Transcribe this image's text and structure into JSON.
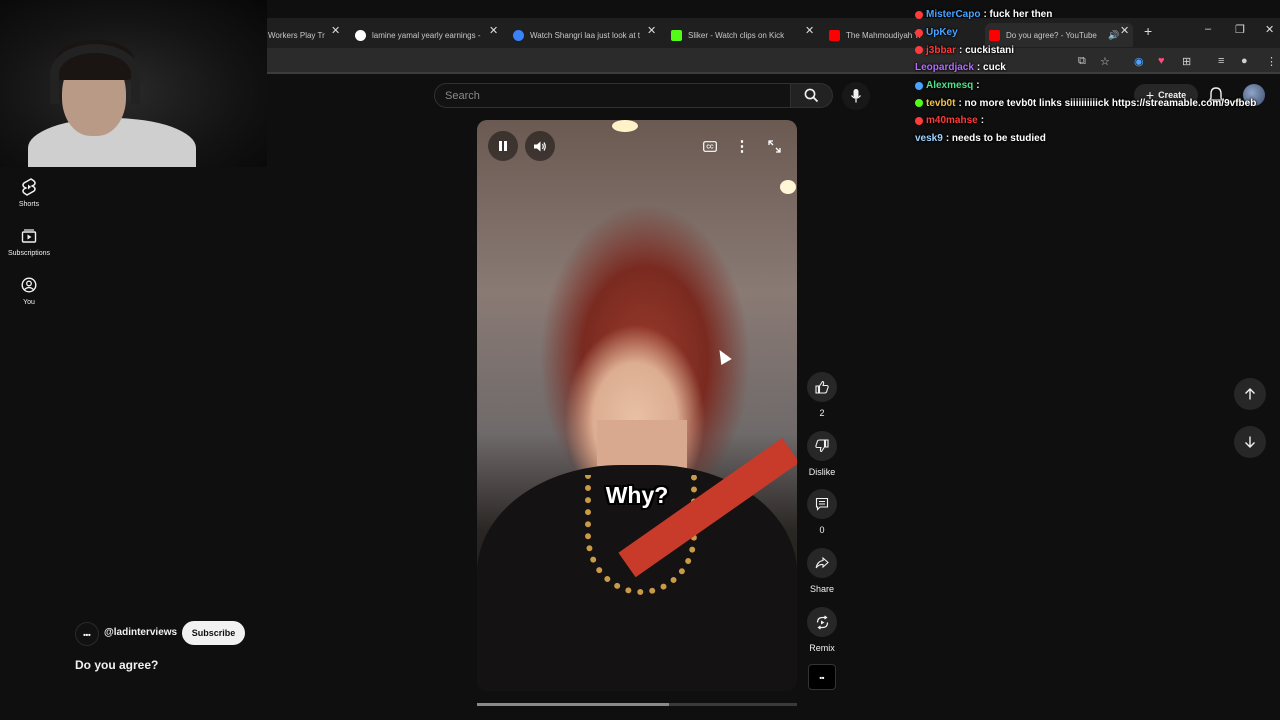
{
  "browser": {
    "tabs": [
      {
        "title": "Workers Play Tr",
        "color": "#7a7a7a"
      },
      {
        "title": "lamine yamal yearly earnings -",
        "color": "#4285f4"
      },
      {
        "title": "Watch Shangri laa just look at t",
        "color": "#3b82f6"
      },
      {
        "title": "Sliker - Watch clips on Kick",
        "color": "#53fc18"
      },
      {
        "title": "The Mahmoudiyah Tr",
        "color": "#ff0000"
      },
      {
        "title": "Do you agree? - YouTube",
        "color": "#ff0000"
      }
    ],
    "new_tab_glyph": "+",
    "close_glyph": "✕",
    "win_min": "–",
    "win_max": "❐",
    "win_close": "✕"
  },
  "sidebar": {
    "items": [
      {
        "label": "Shorts",
        "icon": "shorts-icon"
      },
      {
        "label": "Subscriptions",
        "icon": "subscriptions-icon"
      },
      {
        "label": "You",
        "icon": "you-icon"
      }
    ]
  },
  "search": {
    "placeholder": "Search"
  },
  "header": {
    "create_label": "Create"
  },
  "video": {
    "caption": "Why?",
    "title": "Do you agree?",
    "channel_handle": "@ladinterviews",
    "subscribe_label": "Subscribe",
    "progress_fraction": 0.6
  },
  "actions": {
    "like_count": "2",
    "dislike_label": "Dislike",
    "comment_count": "0",
    "share_label": "Share",
    "remix_label": "Remix"
  },
  "chat": [
    {
      "user": "MisterCapo",
      "user_color": "#4aa3ff",
      "badge": "#ff3b3b",
      "msg": ": fuck her then"
    },
    {
      "user": "UpKey",
      "user_color": "#4aa3ff",
      "badge": "#ff3b3b",
      "msg": ""
    },
    {
      "user": "j3bbar",
      "user_color": "#ff3b3b",
      "badge": "#ff3b3b",
      "msg": ": cuckistani"
    },
    {
      "user": "Leopardjack",
      "user_color": "#b46bff",
      "badge": "",
      "msg": ": cuck"
    },
    {
      "user": "Alexmesq",
      "user_color": "#4fe08a",
      "badge": "#4aa3ff",
      "msg": ":"
    },
    {
      "user": "tevb0t",
      "user_color": "#f0c24a",
      "badge": "#53fc18",
      "msg": ": no more tevb0t links siiiiiiiiiick https://streamable.com/9vfbeb"
    },
    {
      "user": "m40mahse",
      "user_color": "#ff3b3b",
      "badge": "#ff3b3b",
      "msg": ":"
    },
    {
      "user": "vesk9",
      "user_color": "#9fd3ff",
      "badge": "",
      "msg": ": needs to be studied"
    }
  ],
  "colors": {
    "background": "#0f0f0f",
    "accent": "#ff0000"
  }
}
